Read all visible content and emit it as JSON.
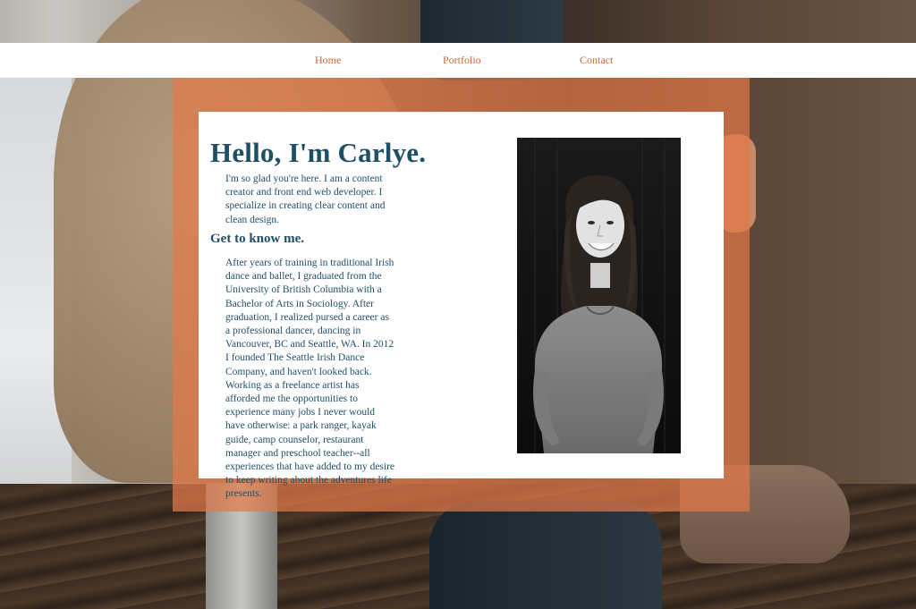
{
  "nav": {
    "items": [
      {
        "label": "Home"
      },
      {
        "label": "Portfolio"
      },
      {
        "label": "Contact"
      }
    ]
  },
  "hero": {
    "title": "Hello, I'm Carlye.",
    "intro": "I'm so glad you're here. I am a content creator and front end web developer. I specialize in creating clear content and clean design."
  },
  "about": {
    "heading": "Get to know me.",
    "body": "After years of training in traditional Irish dance and ballet, I graduated from the University of British Columbia with a Bachelor of Arts in Sociology. After graduation, I realized pursed a career as a professional dancer, dancing in Vancouver, BC and Seattle, WA. In 2012 I founded The Seattle Irish Dance Company, and haven't looked back. Working as a freelance artist has afforded me the opportunities to experience many jobs I never would have otherwise: a park ranger, kayak guide, camp counselor, restaurant manager and preschool teacher--all experiences that have added to my desire to keep writing about the adventures life presents."
  },
  "colors": {
    "accent": "#c9653a",
    "panel": "#e27848",
    "heading_text": "#1f4e68"
  },
  "icons": {
    "photo": "portrait-photo"
  }
}
